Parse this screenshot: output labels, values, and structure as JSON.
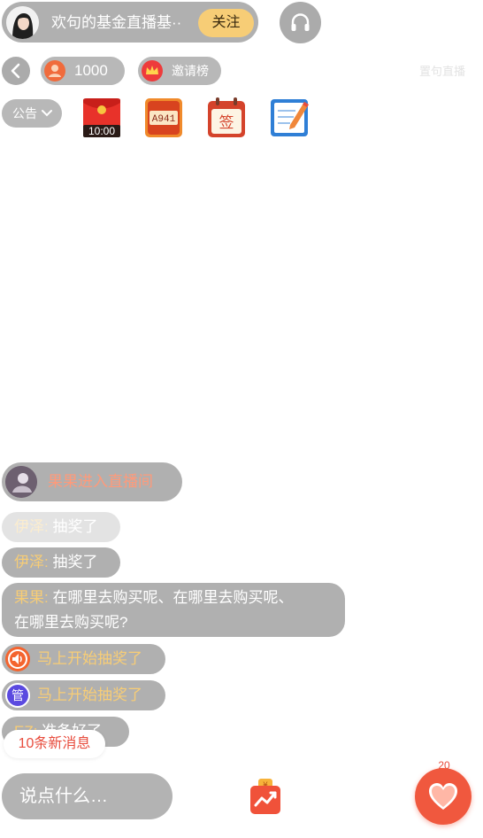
{
  "header": {
    "host_name": "欢句的基金直播基··",
    "follow_label": "关注"
  },
  "stats": {
    "likes_count": "1000",
    "invite_label": "邀请榜",
    "watermark": "置句直播"
  },
  "notice": {
    "label": "公告",
    "activities": [
      {
        "name": "red-envelope",
        "text": "10:00"
      },
      {
        "name": "lottery-ticket",
        "text": "A941"
      },
      {
        "name": "sign-in-calendar",
        "text": "签"
      },
      {
        "name": "notepad",
        "text": ""
      }
    ]
  },
  "chat": {
    "enter_text": "果果进入直播间",
    "messages": [
      {
        "user": "伊泽",
        "text": "抽奖了",
        "faded": true
      },
      {
        "user": "伊泽",
        "text": "抽奖了",
        "faded": false
      },
      {
        "user": "果果",
        "text": "在哪里去购买呢、在哪里去购买呢、在哪里去购买呢?",
        "line1": "在哪里去购买呢、在哪里去购买呢、",
        "line2": "在哪里去购买呢?"
      },
      {
        "type": "speaker",
        "text": "马上开始抽奖了"
      },
      {
        "type": "admin",
        "badge": "管",
        "text": "马上开始抽奖了"
      },
      {
        "user": "EZ",
        "text": "准备好了"
      }
    ],
    "new_messages_label": "10条新消息"
  },
  "footer": {
    "input_placeholder": "说点什么…",
    "like_count": "20"
  },
  "colors": {
    "accent_yellow": "#f7cd76",
    "accent_red": "#e84c3d",
    "bubble_gray": "#969696"
  }
}
